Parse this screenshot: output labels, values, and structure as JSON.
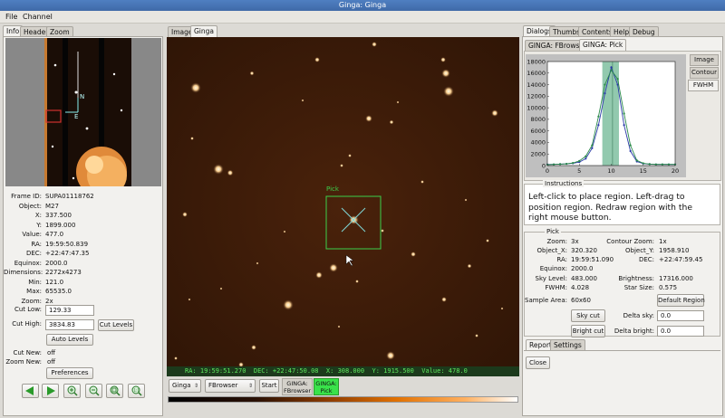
{
  "window": {
    "title": "Ginga: Ginga"
  },
  "menubar": {
    "file": "File",
    "channel": "Channel"
  },
  "left_tabs": [
    "Info",
    "Header",
    "Zoom"
  ],
  "info": {
    "fields": [
      {
        "label": "Frame ID:",
        "value": "SUPA01118762"
      },
      {
        "label": "Object:",
        "value": "M27"
      },
      {
        "label": "X:",
        "value": "337.500"
      },
      {
        "label": "Y:",
        "value": "1899.000"
      },
      {
        "label": "Value:",
        "value": "477.0"
      },
      {
        "label": "RA:",
        "value": "19:59:50.839"
      },
      {
        "label": "DEC:",
        "value": "+22:47:47.35"
      },
      {
        "label": "Equinox:",
        "value": "2000.0"
      },
      {
        "label": "Dimensions:",
        "value": "2272x4273"
      },
      {
        "label": "Min:",
        "value": "121.0"
      },
      {
        "label": "Max:",
        "value": "65535.0"
      },
      {
        "label": "Zoom:",
        "value": "2x"
      }
    ],
    "cut_low_label": "Cut Low:",
    "cut_low_value": "129.33",
    "cut_high_label": "Cut High:",
    "cut_high_value": "3834.83",
    "cut_levels_button": "Cut Levels",
    "auto_levels_button": "Auto Levels",
    "cut_new_label": "Cut New:",
    "cut_new_value": "off",
    "zoom_new_label": "Zoom New:",
    "zoom_new_value": "off",
    "preferences_button": "Preferences"
  },
  "pan": {
    "n_label": "N",
    "e_label": "E"
  },
  "center_tabs": [
    "Image",
    "Ginga"
  ],
  "viewer": {
    "pick_label": "Pick",
    "status_text": "RA: 19:59:51.270  DEC: +22:47:50.08  X: 308.000  Y: 1915.500  Value: 478.0"
  },
  "bottom_bar": {
    "channel_select": "Ginga",
    "browser_select": "FBrowser",
    "start_button": "Start",
    "op_tab1": "GINGA:\nFBrowser",
    "op_tab2": "GINGA:\nPick"
  },
  "right_tabs": [
    "Dialogs",
    "Thumbs",
    "Contents",
    "Help",
    "Debug"
  ],
  "dialog_tabs": [
    "GINGA: FBrowser",
    "GINGA: Pick"
  ],
  "plot_tabs": [
    "Image",
    "Contour",
    "FWHM"
  ],
  "fwhm_plot": {
    "y_ticks": [
      "18000",
      "16000",
      "14000",
      "12000",
      "10000",
      "8000",
      "6000",
      "4000",
      "2000",
      "0"
    ],
    "x_ticks": [
      "0",
      "5",
      "10",
      "15",
      "20"
    ]
  },
  "chart_data": {
    "type": "line",
    "title": "",
    "xlabel": "",
    "ylabel": "",
    "xlim": [
      0,
      20
    ],
    "ylim": [
      0,
      18000
    ],
    "series": [
      {
        "x": [
          0,
          1,
          2,
          3,
          4,
          5,
          6,
          7,
          8,
          9,
          10,
          11,
          12,
          13,
          14,
          15,
          16,
          17,
          18,
          19,
          20
        ],
        "values": [
          200,
          200,
          250,
          300,
          400,
          600,
          1200,
          3000,
          7000,
          12500,
          17000,
          14000,
          7000,
          2500,
          700,
          350,
          250,
          200,
          200,
          200,
          200
        ]
      },
      {
        "x": [
          0,
          1,
          2,
          3,
          4,
          5,
          6,
          7,
          8,
          9,
          10,
          11,
          12,
          13,
          14,
          15,
          16,
          17,
          18,
          19,
          20
        ],
        "values": [
          150,
          200,
          250,
          300,
          450,
          800,
          1600,
          3500,
          8500,
          14000,
          16500,
          15000,
          9000,
          3500,
          900,
          400,
          250,
          200,
          200,
          200,
          200
        ]
      }
    ]
  },
  "instructions": {
    "title": "Instructions",
    "line1": "Left-click to place region.  Left-drag to",
    "line2": "position region.  Redraw region with the",
    "line3": "right mouse button."
  },
  "pick": {
    "title": "Pick",
    "zoom_label": "Zoom:",
    "zoom_value": "3x",
    "contour_zoom_label": "Contour Zoom:",
    "contour_zoom_value": "1x",
    "object_x_label": "Object_X:",
    "object_x_value": "320.320",
    "object_y_label": "Object_Y:",
    "object_y_value": "1958.910",
    "ra_label": "RA:",
    "ra_value": "19:59:51.090",
    "dec_label": "DEC:",
    "dec_value": "+22:47:59.45",
    "equinox_label": "Equinox:",
    "equinox_value": "2000.0",
    "sky_label": "Sky Level:",
    "sky_value": "483.000",
    "brightness_label": "Brightness:",
    "brightness_value": "17316.000",
    "fwhm_label": "FWHM:",
    "fwhm_value": "4.028",
    "starsize_label": "Star Size:",
    "starsize_value": "0.575",
    "sample_label": "Sample Area:",
    "sample_value": "60x60",
    "default_region_button": "Default Region",
    "sky_cut_button": "Sky cut",
    "bright_cut_button": "Bright cut",
    "delta_sky_label": "Delta sky:",
    "delta_sky_value": "0.0",
    "delta_bright_label": "Delta bright:",
    "delta_bright_value": "0.0"
  },
  "report_tabs": [
    "Report",
    "Settings"
  ],
  "close_button": "Close",
  "colors": {
    "accent": "#3f6aa8",
    "status_green": "#39e24a",
    "image_bg": "#3a1a08"
  }
}
